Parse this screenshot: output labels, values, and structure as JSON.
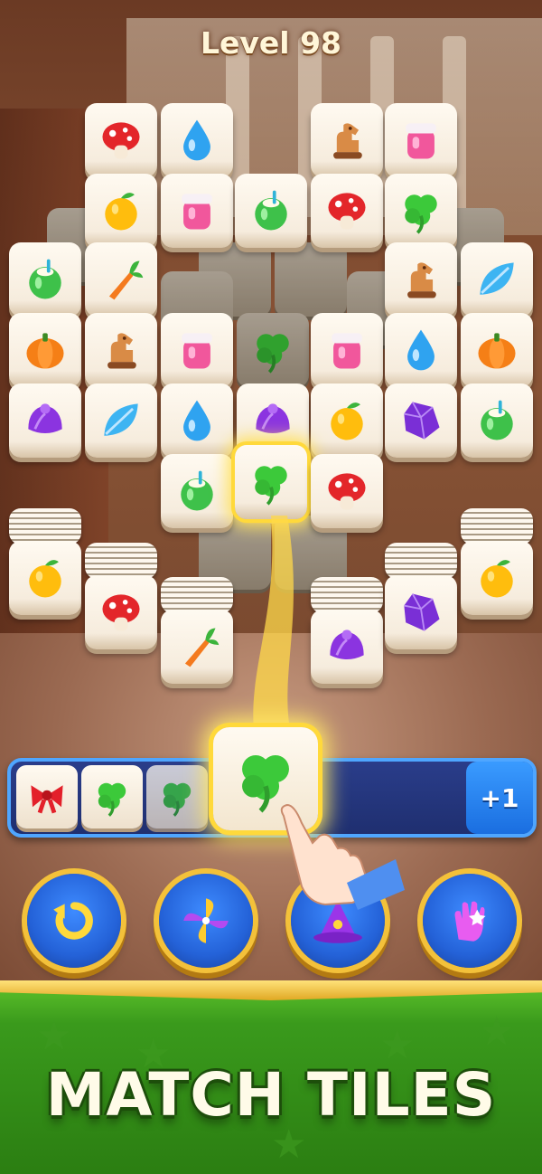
{
  "level": {
    "label": "Level 98"
  },
  "match_bar": {
    "extra_slot_label": "+1",
    "slots": [
      "bow",
      "clover",
      "clover"
    ],
    "incoming": "clover"
  },
  "boosters": [
    {
      "name": "undo",
      "icon": "undo-icon"
    },
    {
      "name": "shuffle",
      "icon": "pinwheel-icon"
    },
    {
      "name": "magic",
      "icon": "wizard-hat-icon"
    },
    {
      "name": "hint",
      "icon": "glove-icon"
    }
  ],
  "banner": {
    "headline": "MATCH TILES"
  },
  "board": {
    "rows": [
      [
        "mushroom",
        "water-drop",
        "",
        "horse",
        "jam-jar"
      ],
      [
        "orange",
        "jam-jar",
        "coconut",
        "mushroom",
        "clover"
      ],
      [
        "coconut",
        "carrot",
        "",
        "",
        "horse",
        "leaf"
      ],
      [
        "pumpkin",
        "horse",
        "jam-jar",
        "clover",
        "jam-jar",
        "water-drop",
        "pumpkin"
      ],
      [
        "shell",
        "leaf",
        "water-drop",
        "shell",
        "orange",
        "gem",
        "coconut"
      ],
      [
        "coconut",
        "clover",
        "mushroom"
      ],
      [
        "orange",
        "mushroom",
        "carrot",
        "shell",
        "gem",
        "orange"
      ]
    ]
  },
  "colors": {
    "accent": "#ffd93b",
    "bar": "#1f2f70",
    "booster": "#2462d8",
    "footer": "#2b7e12"
  }
}
